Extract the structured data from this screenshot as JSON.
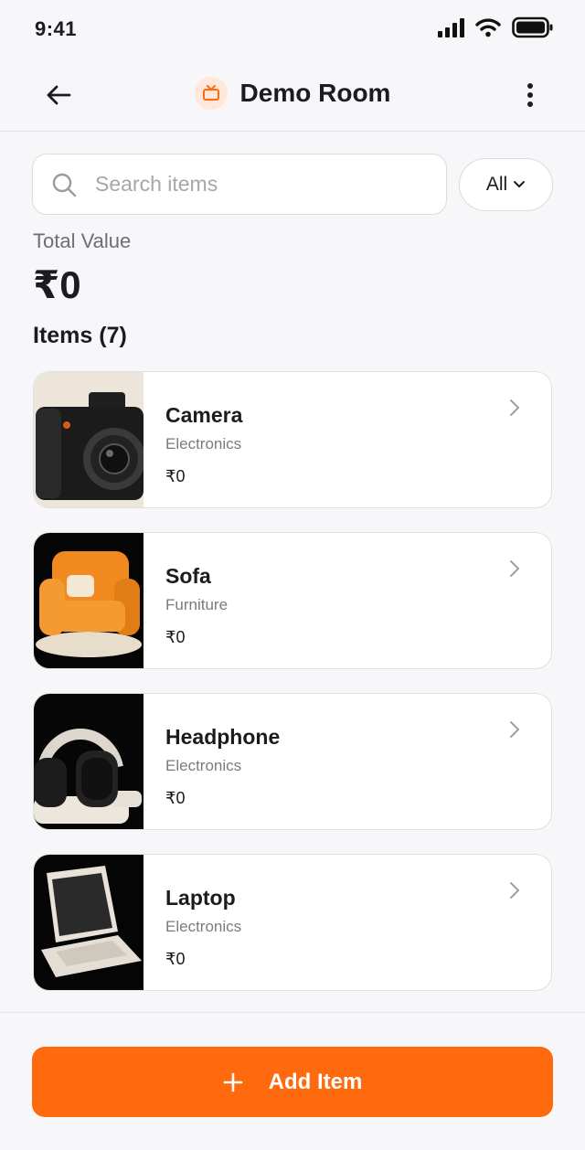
{
  "status_bar": {
    "time": "9:41"
  },
  "header": {
    "title": "Demo Room",
    "room_icon": "tv-icon"
  },
  "search": {
    "placeholder": "Search items",
    "value": ""
  },
  "filter": {
    "selected": "All"
  },
  "summary": {
    "total_label": "Total Value",
    "total_value": "₹0",
    "items_heading": "Items (7)"
  },
  "items": [
    {
      "name": "Camera",
      "category": "Electronics",
      "price": "₹0",
      "image": "camera-photo"
    },
    {
      "name": "Sofa",
      "category": "Furniture",
      "price": "₹0",
      "image": "armchair-photo"
    },
    {
      "name": "Headphone",
      "category": "Electronics",
      "price": "₹0",
      "image": "headphone-photo"
    },
    {
      "name": "Laptop",
      "category": "Electronics",
      "price": "₹0",
      "image": "laptop-photo"
    }
  ],
  "actions": {
    "add_item": "Add Item"
  },
  "colors": {
    "accent": "#ff6a0e",
    "accent_soft": "#ffe8d9",
    "background": "#f7f7f9"
  }
}
